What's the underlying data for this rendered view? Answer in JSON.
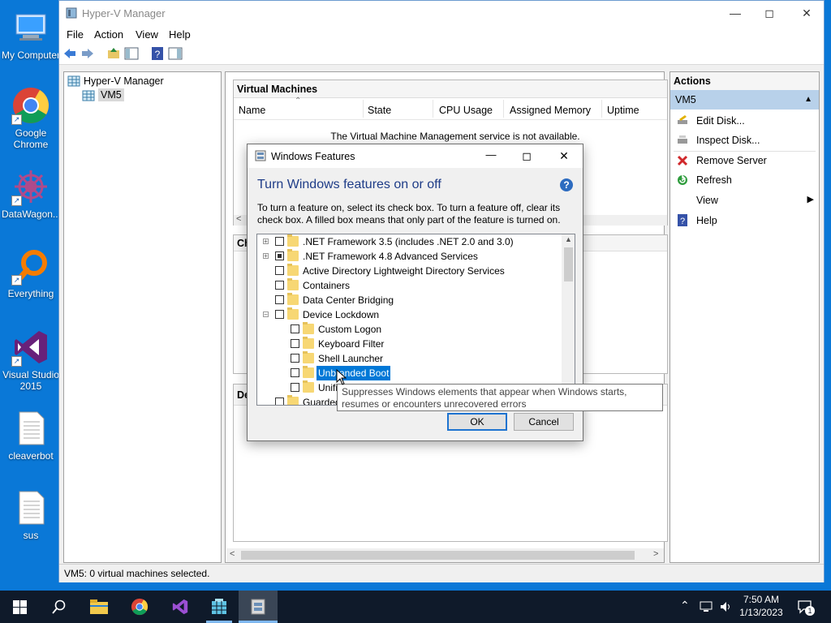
{
  "desktop": {
    "icons": [
      {
        "label": "My Computer"
      },
      {
        "label": "Google Chrome"
      },
      {
        "label": "DataWagon..."
      },
      {
        "label": "Everything"
      },
      {
        "label": "Visual Studio 2015"
      },
      {
        "label": "cleaverbot"
      },
      {
        "label": "sus"
      }
    ]
  },
  "hyperv": {
    "title": "Hyper-V Manager",
    "menu": [
      "File",
      "Action",
      "View",
      "Help"
    ],
    "tree": {
      "root": "Hyper-V Manager",
      "child": "VM5"
    },
    "vm_section": {
      "title": "Virtual Machines",
      "columns": [
        "Name",
        "State",
        "CPU Usage",
        "Assigned Memory",
        "Uptime"
      ],
      "empty_message": "The Virtual Machine Management service is not available."
    },
    "checkpoints_stub": "Ch",
    "details_stub": "De",
    "status": "VM5:  0 virtual machines selected."
  },
  "actions": {
    "header": "Actions",
    "group": "VM5",
    "items": [
      "Edit Disk...",
      "Inspect Disk...",
      "Remove Server",
      "Refresh",
      "View",
      "Help"
    ]
  },
  "dialog": {
    "title": "Windows Features",
    "heading": "Turn Windows features on or off",
    "description": "To turn a feature on, select its check box. To turn a feature off, clear its check box. A filled box means that only part of the feature is turned on.",
    "features": [
      {
        "label": ".NET Framework 3.5 (includes .NET 2.0 and 3.0)",
        "state": "unchecked",
        "expander": "+",
        "level": 0
      },
      {
        "label": ".NET Framework 4.8 Advanced Services",
        "state": "partial",
        "expander": "+",
        "level": 0
      },
      {
        "label": "Active Directory Lightweight Directory Services",
        "state": "unchecked",
        "expander": "",
        "level": 0
      },
      {
        "label": "Containers",
        "state": "unchecked",
        "expander": "",
        "level": 0
      },
      {
        "label": "Data Center Bridging",
        "state": "unchecked",
        "expander": "",
        "level": 0
      },
      {
        "label": "Device Lockdown",
        "state": "unchecked",
        "expander": "−",
        "level": 0
      },
      {
        "label": "Custom Logon",
        "state": "unchecked",
        "expander": "",
        "level": 1
      },
      {
        "label": "Keyboard Filter",
        "state": "unchecked",
        "expander": "",
        "level": 1
      },
      {
        "label": "Shell Launcher",
        "state": "unchecked",
        "expander": "",
        "level": 1
      },
      {
        "label": "Unbranded Boot",
        "state": "unchecked",
        "expander": "",
        "level": 1,
        "selected": true
      },
      {
        "label": "Unifi",
        "state": "unchecked",
        "expander": "",
        "level": 1
      },
      {
        "label": "Guarded",
        "state": "unchecked",
        "expander": "",
        "level": 0
      }
    ],
    "tooltip": "Suppresses Windows elements that appear when Windows starts, resumes or encounters unrecovered errors",
    "ok": "OK",
    "cancel": "Cancel"
  },
  "taskbar": {
    "time": "7:50 AM",
    "date": "1/13/2023",
    "notification_count": "1"
  }
}
